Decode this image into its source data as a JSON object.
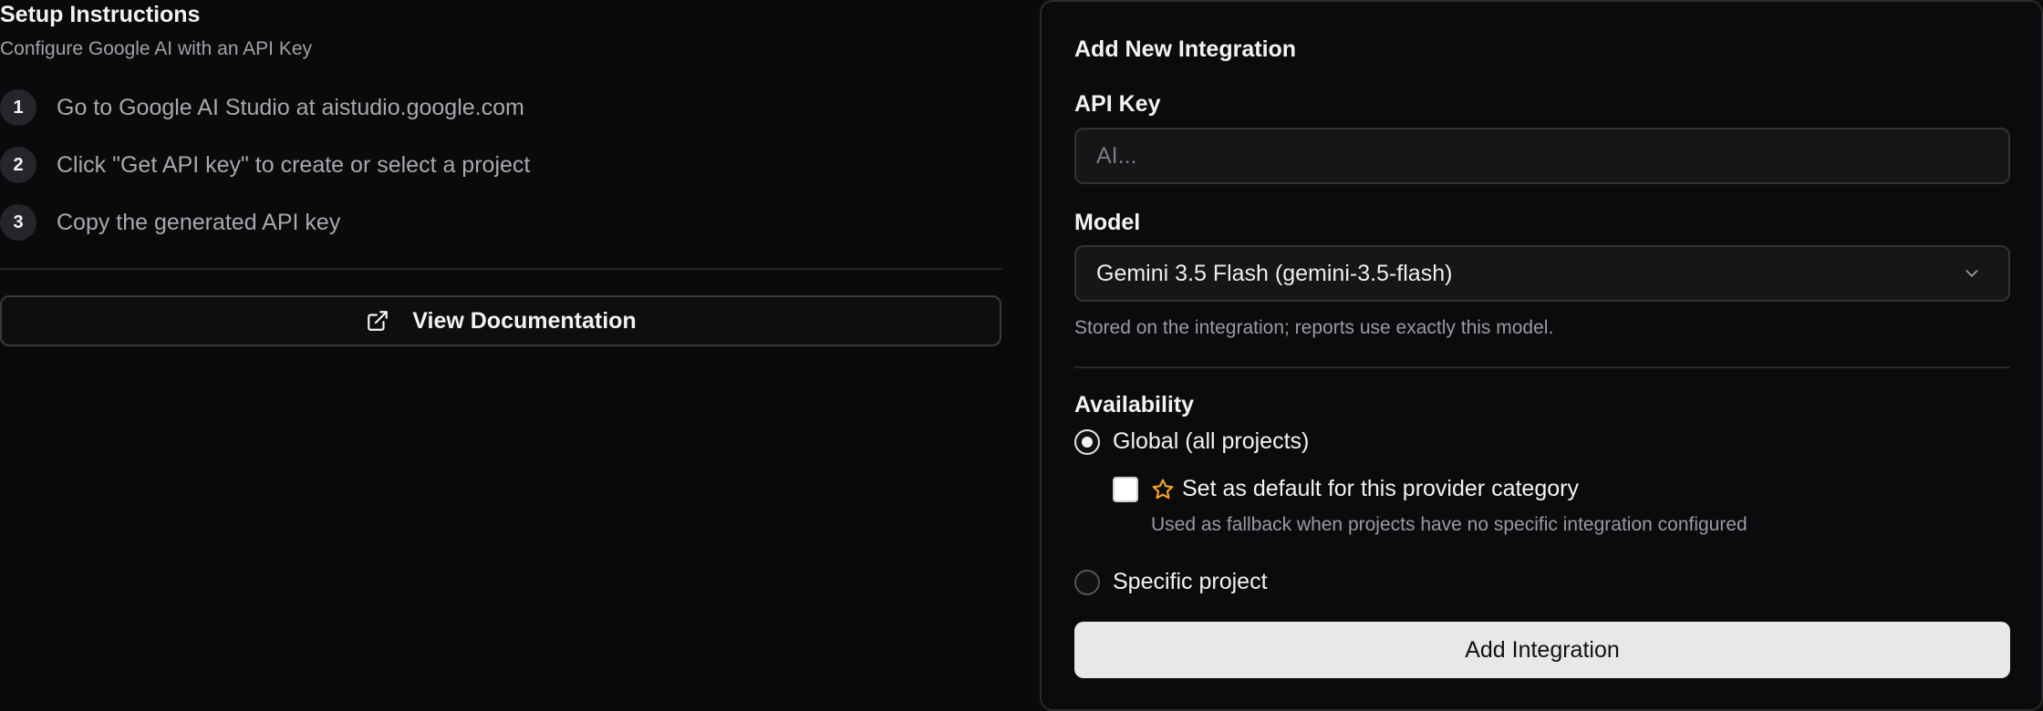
{
  "setup": {
    "title": "Setup Instructions",
    "subtitle": "Configure Google AI with an API Key",
    "steps": [
      {
        "number": "1",
        "text": "Go to Google AI Studio at aistudio.google.com"
      },
      {
        "number": "2",
        "text": "Click \"Get API key\" to create or select a project"
      },
      {
        "number": "3",
        "text": "Copy the generated API key"
      }
    ],
    "doc_button": {
      "label": "View Documentation",
      "icon": "external-link-icon"
    }
  },
  "form": {
    "title": "Add New Integration",
    "api_key": {
      "label": "API Key",
      "value": "",
      "placeholder": "AI..."
    },
    "model": {
      "label": "Model",
      "selected": "Gemini 3.5 Flash (gemini-3.5-flash)",
      "hint": "Stored on the integration; reports use exactly this model.",
      "icon": "chevron-down-icon"
    },
    "availability": {
      "label": "Availability",
      "options": [
        {
          "label": "Global (all projects)",
          "checked": true
        },
        {
          "label": "Specific project",
          "checked": false
        }
      ],
      "default_checkbox": {
        "label": "Set as default for this provider category",
        "checked": false,
        "hint": "Used as fallback when projects have no specific integration configured",
        "icon": "star-icon",
        "icon_color": "#f5a623"
      }
    },
    "submit_label": "Add Integration"
  },
  "colors": {
    "background": "#0a0a0c",
    "accent_star": "#f5a623",
    "button_primary_bg": "#e8e8e8"
  }
}
